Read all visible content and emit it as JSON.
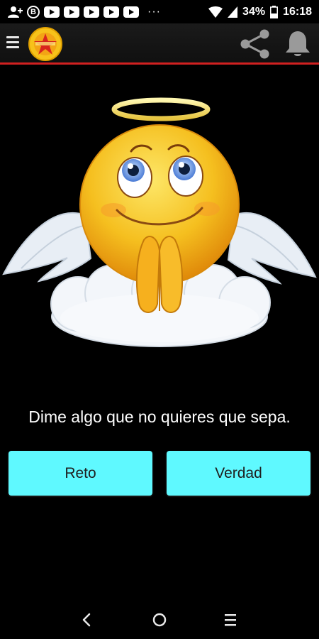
{
  "status_bar": {
    "b_label": "B",
    "dots": "···",
    "battery": "34%",
    "time": "16:18"
  },
  "toolbar": {
    "menu_icon": "hamburger-menu-icon",
    "share_icon": "share-icon",
    "bell_icon": "bell-icon"
  },
  "main": {
    "question": "Dime algo que no quieres que sepa.",
    "buttons": [
      {
        "label": "Reto"
      },
      {
        "label": "Verdad"
      }
    ]
  },
  "colors": {
    "button_bg": "#5ff9ff",
    "toolbar_accent": "#d02020",
    "background": "#000000"
  },
  "nav": {
    "back_icon": "back-icon",
    "home_icon": "home-icon",
    "recent_icon": "recent-apps-icon"
  }
}
